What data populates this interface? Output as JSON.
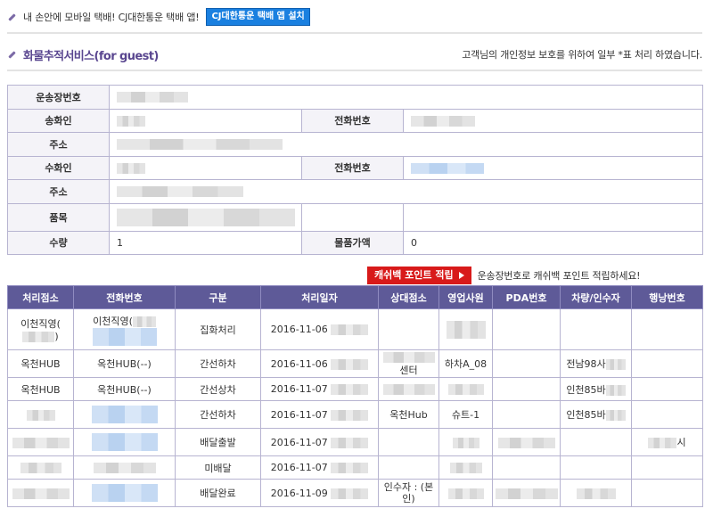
{
  "promo": {
    "text": "내 손안에 모바일 택배! CJ대한통운 택배 앱!",
    "button": "CJ대한통운 택배 앱 설치"
  },
  "section": {
    "title": "화물추적서비스(for guest)",
    "privacy_note": "고객님의 개인정보 보호를 위하여 일부 *표 처리 하였습니다."
  },
  "info": {
    "waybill_label": "운송장번호",
    "sender_label": "송화인",
    "sender_phone_label": "전화번호",
    "sender_addr_label": "주소",
    "receiver_label": "수화인",
    "receiver_phone_label": "전화번호",
    "receiver_addr_label": "주소",
    "item_label": "품목",
    "qty_label": "수량",
    "qty_value": "1",
    "price_label": "물품가액",
    "price_value": "0"
  },
  "cashback": {
    "button": "캐쉬백 포인트 적립",
    "text": "운송장번호로 캐쉬백 포인트 적립하세요!"
  },
  "track": {
    "headers": [
      "처리점소",
      "전화번호",
      "구분",
      "처리일자",
      "상대점소",
      "영업사원",
      "PDA번호",
      "차량/인수자",
      "행낭번호"
    ],
    "rows": [
      {
        "branch": "이천직영(",
        "phone": "이천직영(",
        "status": "집화처리",
        "date": "2016-11-06",
        "partner": "",
        "sales": "",
        "pda": "",
        "vehicle": "",
        "bag": ""
      },
      {
        "branch": "옥천HUB",
        "phone": "옥천HUB(--)",
        "status": "간선하차",
        "date": "2016-11-06",
        "partner": "센터",
        "sales": "하차A_08",
        "pda": "",
        "vehicle": "전남98사",
        "bag": ""
      },
      {
        "branch": "옥천HUB",
        "phone": "옥천HUB(--)",
        "status": "간선상차",
        "date": "2016-11-07",
        "partner": "",
        "sales": "",
        "pda": "",
        "vehicle": "인천85바",
        "bag": ""
      },
      {
        "branch": "",
        "phone": "",
        "status": "간선하차",
        "date": "2016-11-07",
        "partner": "옥천Hub",
        "sales": "슈트-1",
        "pda": "",
        "vehicle": "인천85바",
        "bag": ""
      },
      {
        "branch": "",
        "phone": "",
        "status": "배달출발",
        "date": "2016-11-07",
        "partner": "",
        "sales": "",
        "pda": "",
        "vehicle": "",
        "bag": "시"
      },
      {
        "branch": "",
        "phone": "",
        "status": "미배달",
        "date": "2016-11-07",
        "partner": "",
        "sales": "",
        "pda": "",
        "vehicle": "",
        "bag": ""
      },
      {
        "branch": "",
        "phone": "",
        "status": "배달완료",
        "date": "2016-11-09",
        "partner": "인수자 : (본인)",
        "sales": "",
        "pda": "",
        "vehicle": "",
        "bag": ""
      }
    ]
  }
}
